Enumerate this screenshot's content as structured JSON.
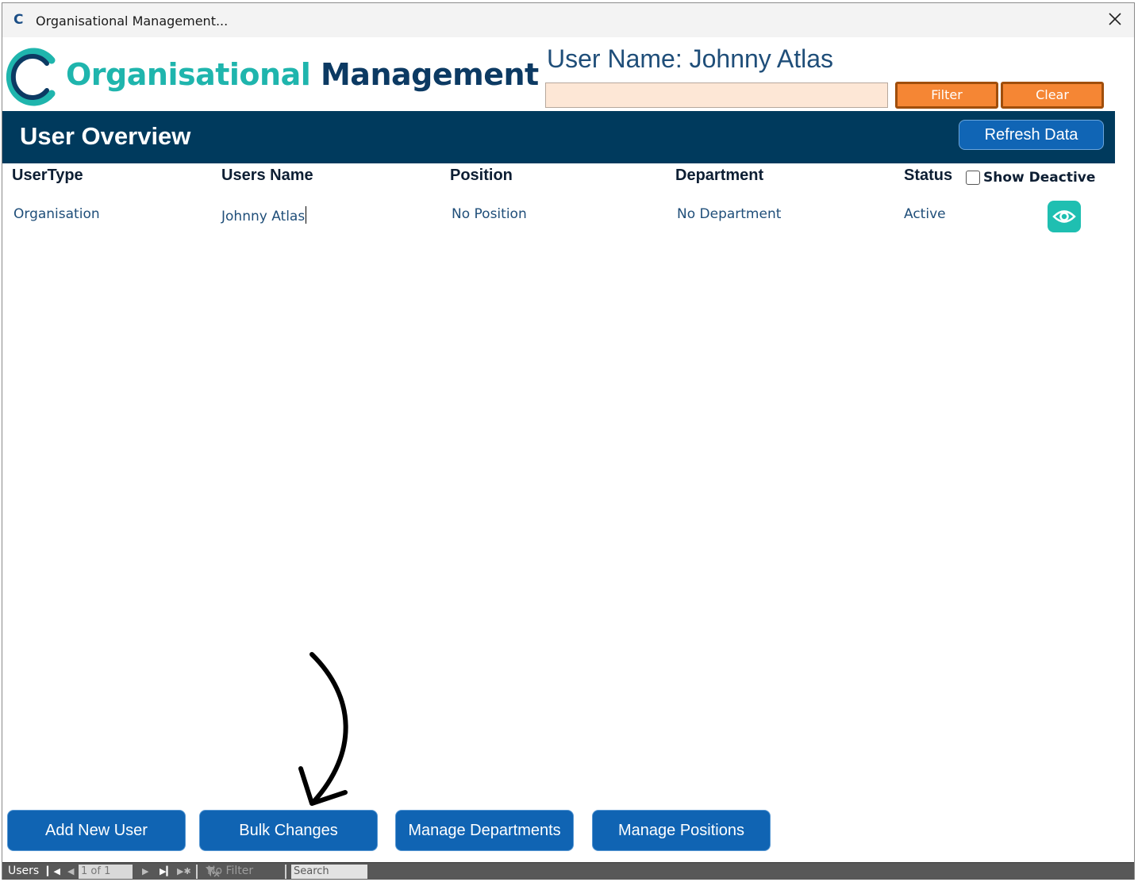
{
  "window": {
    "title": "Organisational Management...",
    "app_icon_glyph": "C"
  },
  "brand": {
    "word1": "Organisational",
    "word2": "Management",
    "teal": "#1fb5ad",
    "navy": "#0c3a63"
  },
  "header": {
    "user_name": "User Name: Johnny Atlas",
    "filter_value": "",
    "filter_label": "Filter",
    "clear_label": "Clear"
  },
  "overview": {
    "title": "User Overview",
    "refresh_label": "Refresh Data",
    "band_color": "#003a5d"
  },
  "table": {
    "columns": [
      "UserType",
      "Users Name",
      "Position",
      "Department",
      "Status"
    ],
    "show_deactive_label": "Show Deactive",
    "show_deactive_checked": false,
    "rows": [
      {
        "user_type": "Organisation",
        "users_name": "Johnny Atlas",
        "position": "No Position",
        "department": "No Department",
        "status": "Active",
        "action_icon": "eye-icon"
      }
    ]
  },
  "actions": {
    "add_new_user": "Add New User",
    "bulk_changes": "Bulk Changes",
    "manage_departments": "Manage Departments",
    "manage_positions": "Manage Positions"
  },
  "navigation": {
    "label": "Users",
    "record_count": "1 of 1",
    "filter_status": "No Filter",
    "search_placeholder": "Search"
  },
  "colors": {
    "accent_blue": "#1064b3",
    "orange": "#f58634",
    "eye_teal": "#1fbfb1"
  }
}
